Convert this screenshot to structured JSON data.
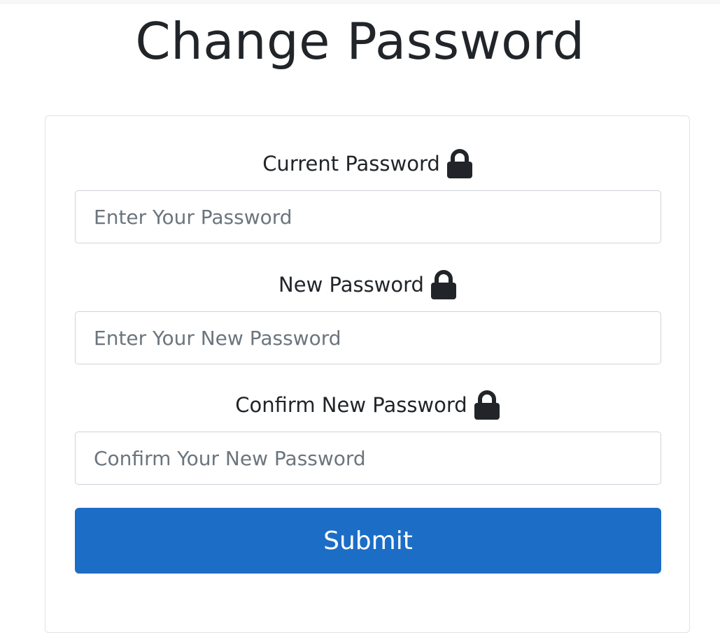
{
  "page": {
    "title": "Change Password"
  },
  "form": {
    "current": {
      "label": "Current Password",
      "icon": "lock-icon",
      "placeholder": "Enter Your Password",
      "value": ""
    },
    "new": {
      "label": "New Password",
      "icon": "lock-icon",
      "placeholder": "Enter Your New Password",
      "value": ""
    },
    "confirm": {
      "label": "Confirm New Password",
      "icon": "lock-icon",
      "placeholder": "Confirm Your New Password",
      "value": ""
    },
    "submit_label": "Submit"
  },
  "colors": {
    "accent": "#1c6dc5",
    "text": "#212529",
    "border": "#ced4da"
  }
}
